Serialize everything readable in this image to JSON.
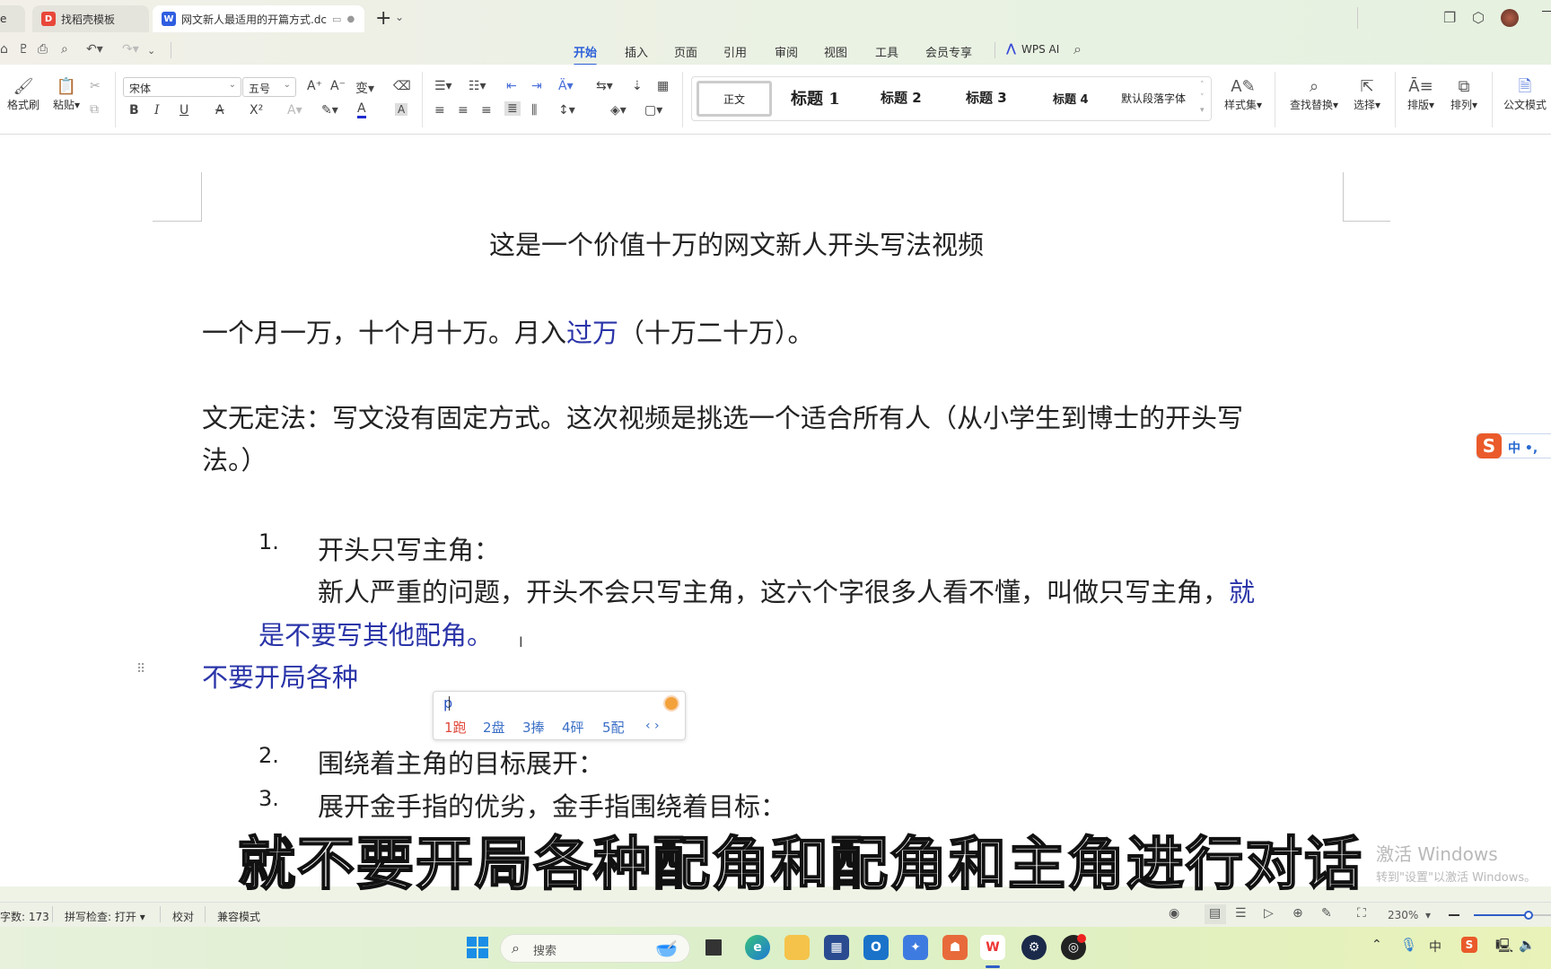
{
  "titlebar": {
    "tabs": [
      {
        "label": "e",
        "icon": "app-icon"
      },
      {
        "label": "找稻壳模板",
        "icon": "docer-icon"
      },
      {
        "label": "网文新人最适用的开篇方式.dc",
        "icon": "wps-writer-icon"
      }
    ],
    "new_tab": "+",
    "new_tab_menu": "⌄"
  },
  "menu": {
    "tabs": [
      "开始",
      "插入",
      "页面",
      "引用",
      "审阅",
      "视图",
      "工具",
      "会员专享"
    ],
    "active": "开始",
    "wps_ai": "WPS AI"
  },
  "ribbon": {
    "format_painter": "格式刷",
    "paste": "粘贴",
    "font_name": "宋体",
    "font_size": "五号",
    "styles": [
      "正文",
      "标题 1",
      "标题 2",
      "标题 3",
      "标题 4",
      "默认段落字体"
    ],
    "style_set": "样式集",
    "find_replace": "查找替换",
    "select": "选择",
    "layout": "排版",
    "arrange": "排列",
    "official_mode": "公文模式",
    "bold": "B",
    "italic": "I",
    "underline": "U",
    "strike": "A",
    "superscript": "X²"
  },
  "document": {
    "title": "这是一个价值十万的网文新人开头写法视频",
    "para1_black": "一个月一万，十个月十万。月入",
    "para1_blue": "过万",
    "para1_tail": "（十万二十万）。",
    "para2_line1": "文无定法：写文没有固定方式。这次视频是挑选一个适合所有人（从小学生到博士的开头写",
    "para2_line2": "法。）",
    "item1_num": "1.",
    "item1_title": "开头只写主角：",
    "item1_body_black": "新人严重的问题，开头不会只写主角，这六个字很多人看不懂，叫做只写主角，",
    "item1_body_blue1": "就",
    "item1_body_blue2": "是不要写其他配角。",
    "typing_line": "不要开局各种",
    "item2_num": "2.",
    "item2_title": "围绕着主角的目标展开：",
    "item3_num": "3.",
    "item3_title": "展开金手指的优劣，金手指围绕着目标："
  },
  "ime": {
    "input": "p",
    "candidates": [
      "1跑",
      "2盘",
      "3捧",
      "4砰",
      "5配"
    ],
    "nav": "‹ ›",
    "toolbar": "中 •,"
  },
  "caption": "就不要开局各种配角和配角和主角进行对话",
  "watermark": {
    "line1": "激活 Windows",
    "line2": "转到\"设置\"以激活 Windows。"
  },
  "status": {
    "word_count": "字数: 173",
    "spell_check": "拼写检查: 打开",
    "proofread": "校对",
    "compat_mode": "兼容模式",
    "zoom": "230%",
    "zoom_fraction": 0.72
  },
  "taskbar": {
    "search_placeholder": "搜索"
  }
}
